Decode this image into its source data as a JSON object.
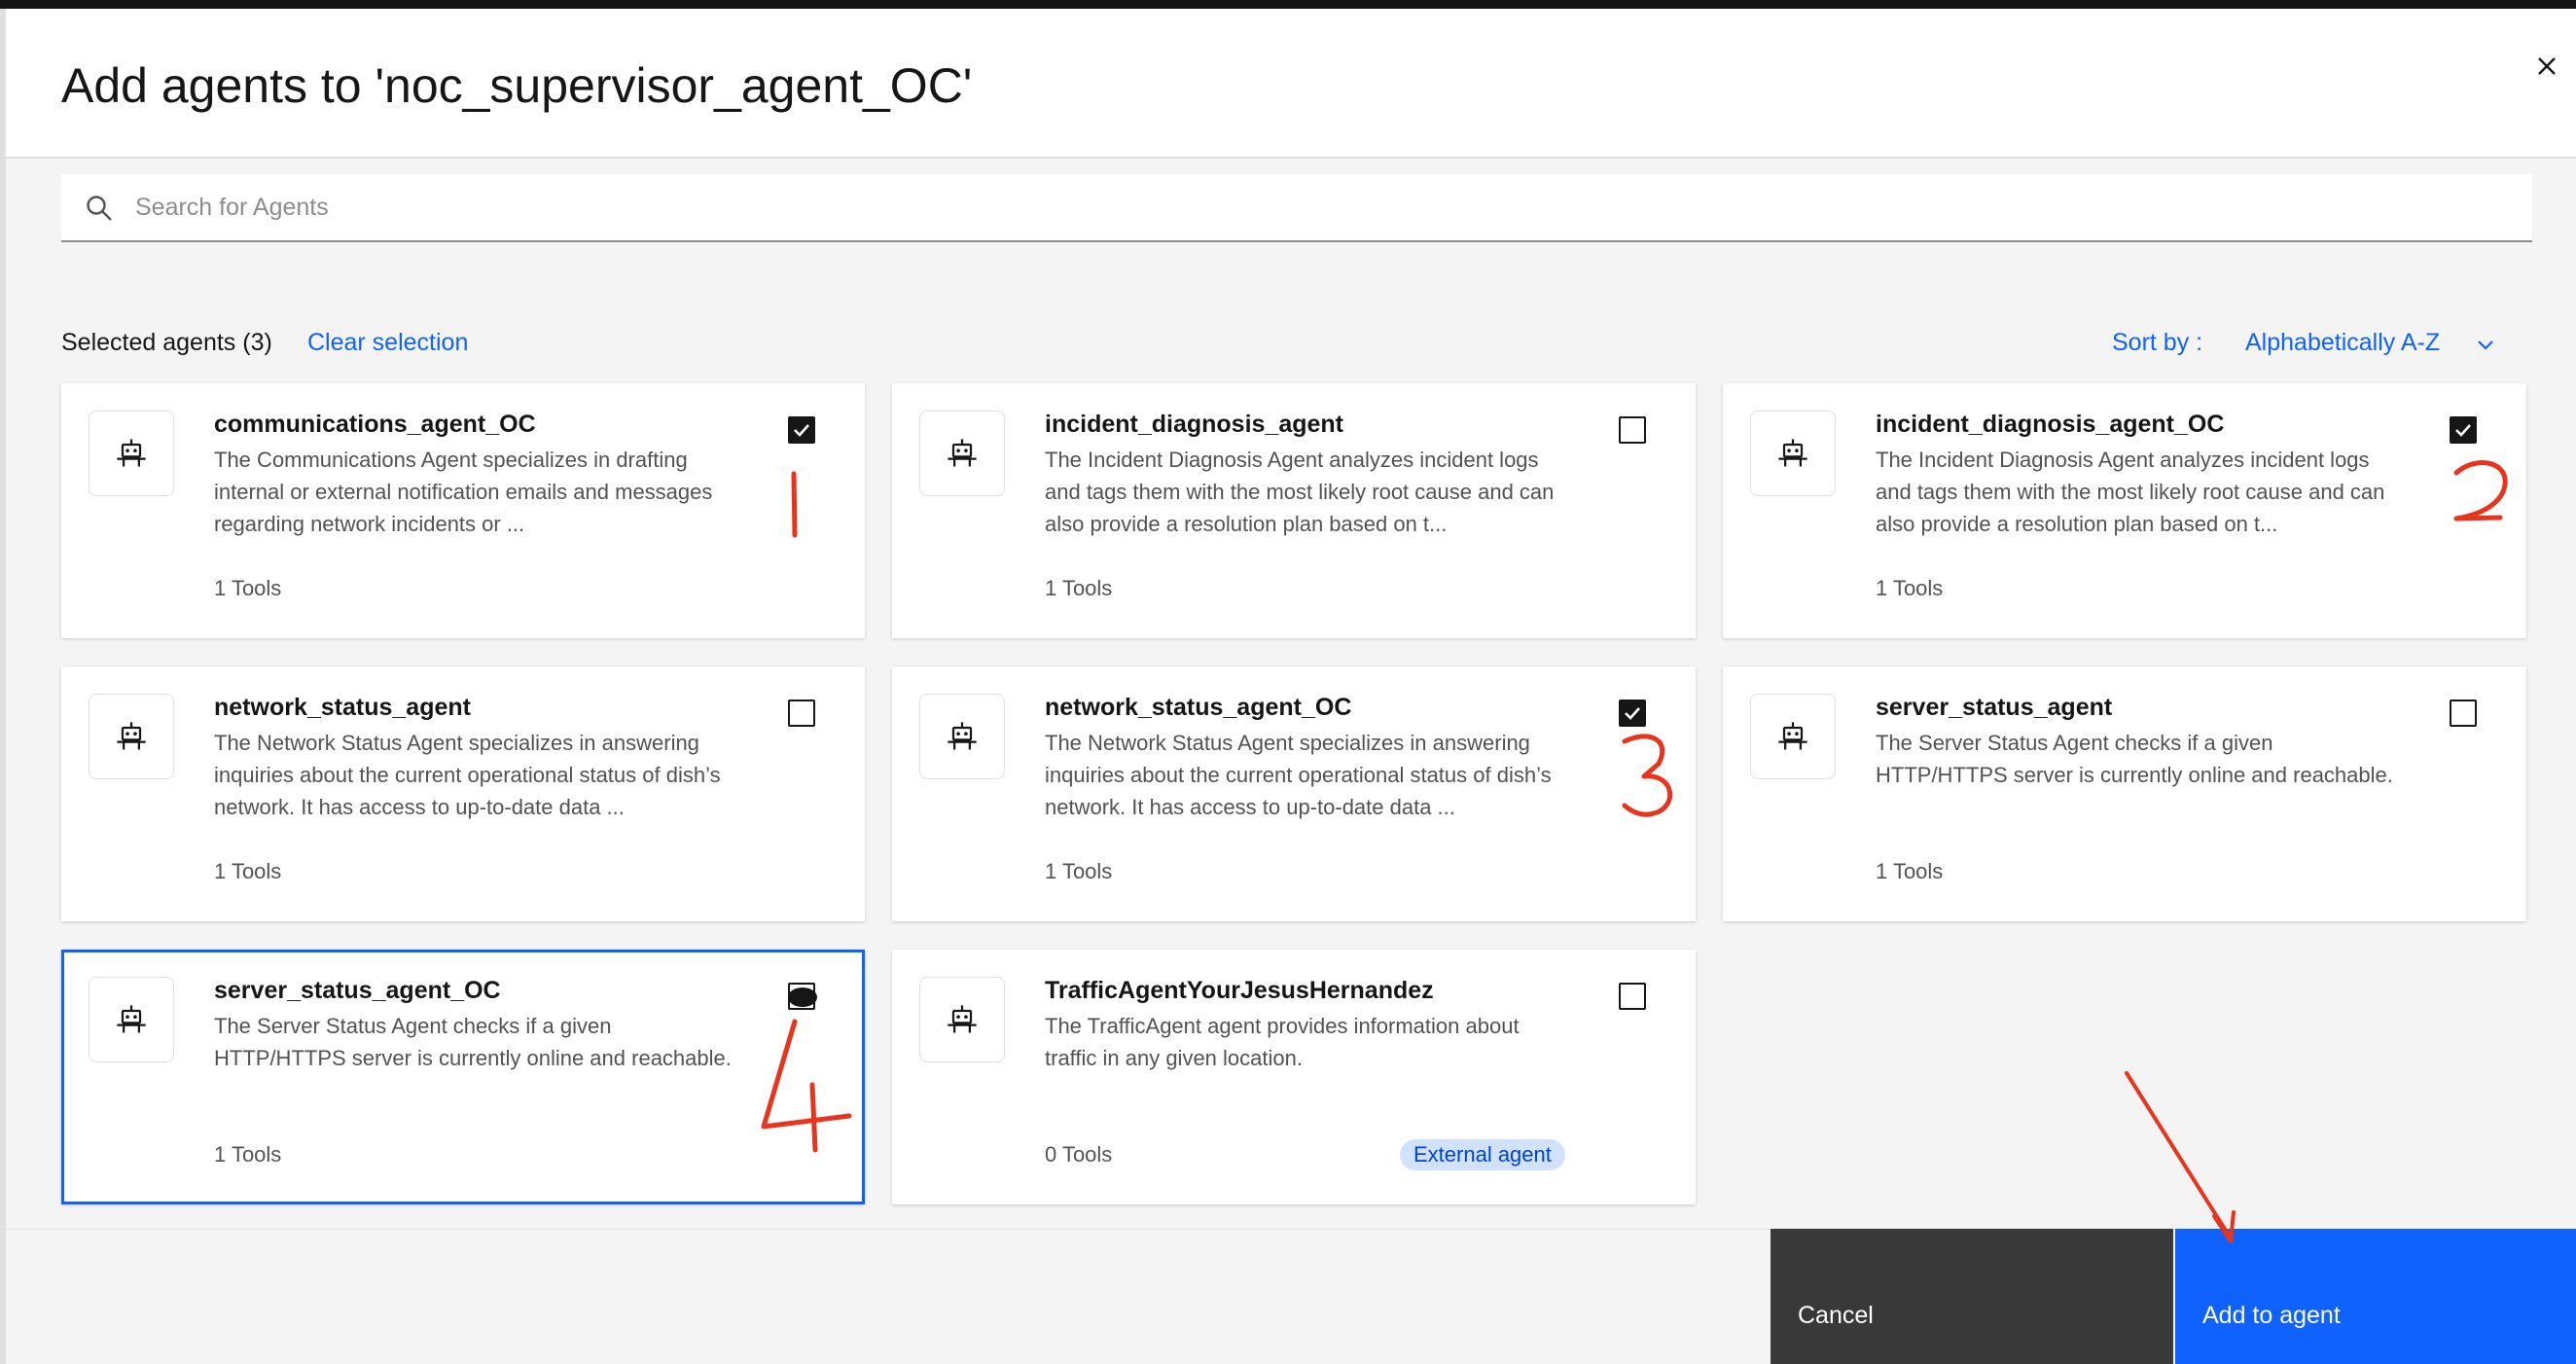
{
  "dialog": {
    "title": "Add agents to 'noc_supervisor_agent_OC'",
    "close_icon": "close-icon"
  },
  "search": {
    "placeholder": "Search for Agents",
    "icon": "search-icon"
  },
  "toolbar": {
    "selected_count": "Selected agents (3)",
    "clear_selection": "Clear selection",
    "sort_label": "Sort by :",
    "sort_value": "Alphabetically A-Z"
  },
  "agents": [
    {
      "name": "communications_agent_OC",
      "description": "The Communications Agent specializes in drafting internal or external notification emails and messages regarding network incidents or ...",
      "tools": "1 Tools",
      "checked": true
    },
    {
      "name": "incident_diagnosis_agent",
      "description": "The Incident Diagnosis Agent analyzes incident logs and tags them with the most likely root cause and can also provide a resolution plan based on t...",
      "tools": "1 Tools",
      "checked": false
    },
    {
      "name": "incident_diagnosis_agent_OC",
      "description": "The Incident Diagnosis Agent analyzes incident logs and tags them with the most likely root cause and can also provide a resolution plan based on t...",
      "tools": "1 Tools",
      "checked": true
    },
    {
      "name": "network_status_agent",
      "description": "The Network Status Agent specializes in answering inquiries about the current operational status of dish’s network. It has access to up-to-date data ...",
      "tools": "1 Tools",
      "checked": false
    },
    {
      "name": "network_status_agent_OC",
      "description": "The Network Status Agent specializes in answering inquiries about the current operational status of dish’s network. It has access to up-to-date data ...",
      "tools": "1 Tools",
      "checked": true
    },
    {
      "name": "server_status_agent",
      "description": "The Server Status Agent checks if a given HTTP/HTTPS server is currently online and reachable.",
      "tools": "1 Tools",
      "checked": false
    },
    {
      "name": "server_status_agent_OC",
      "description": "The Server Status Agent checks if a given HTTP/HTTPS server is currently online and reachable.",
      "tools": "1 Tools",
      "checked": false
    },
    {
      "name": "TrafficAgentYourJesusHernandez",
      "description": "The TrafficAgent agent provides information about traffic in any given location.",
      "tools": "0 Tools",
      "badge": "External agent",
      "checked": false
    }
  ],
  "footer": {
    "cancel": "Cancel",
    "add": "Add to agent"
  },
  "annotations": {
    "color": "#e8341c",
    "labels": [
      "1",
      "2",
      "3",
      "4"
    ]
  },
  "colors": {
    "primary": "#0f62fe",
    "cancel_bg": "#393939",
    "badge_bg": "#d0e2ff"
  }
}
